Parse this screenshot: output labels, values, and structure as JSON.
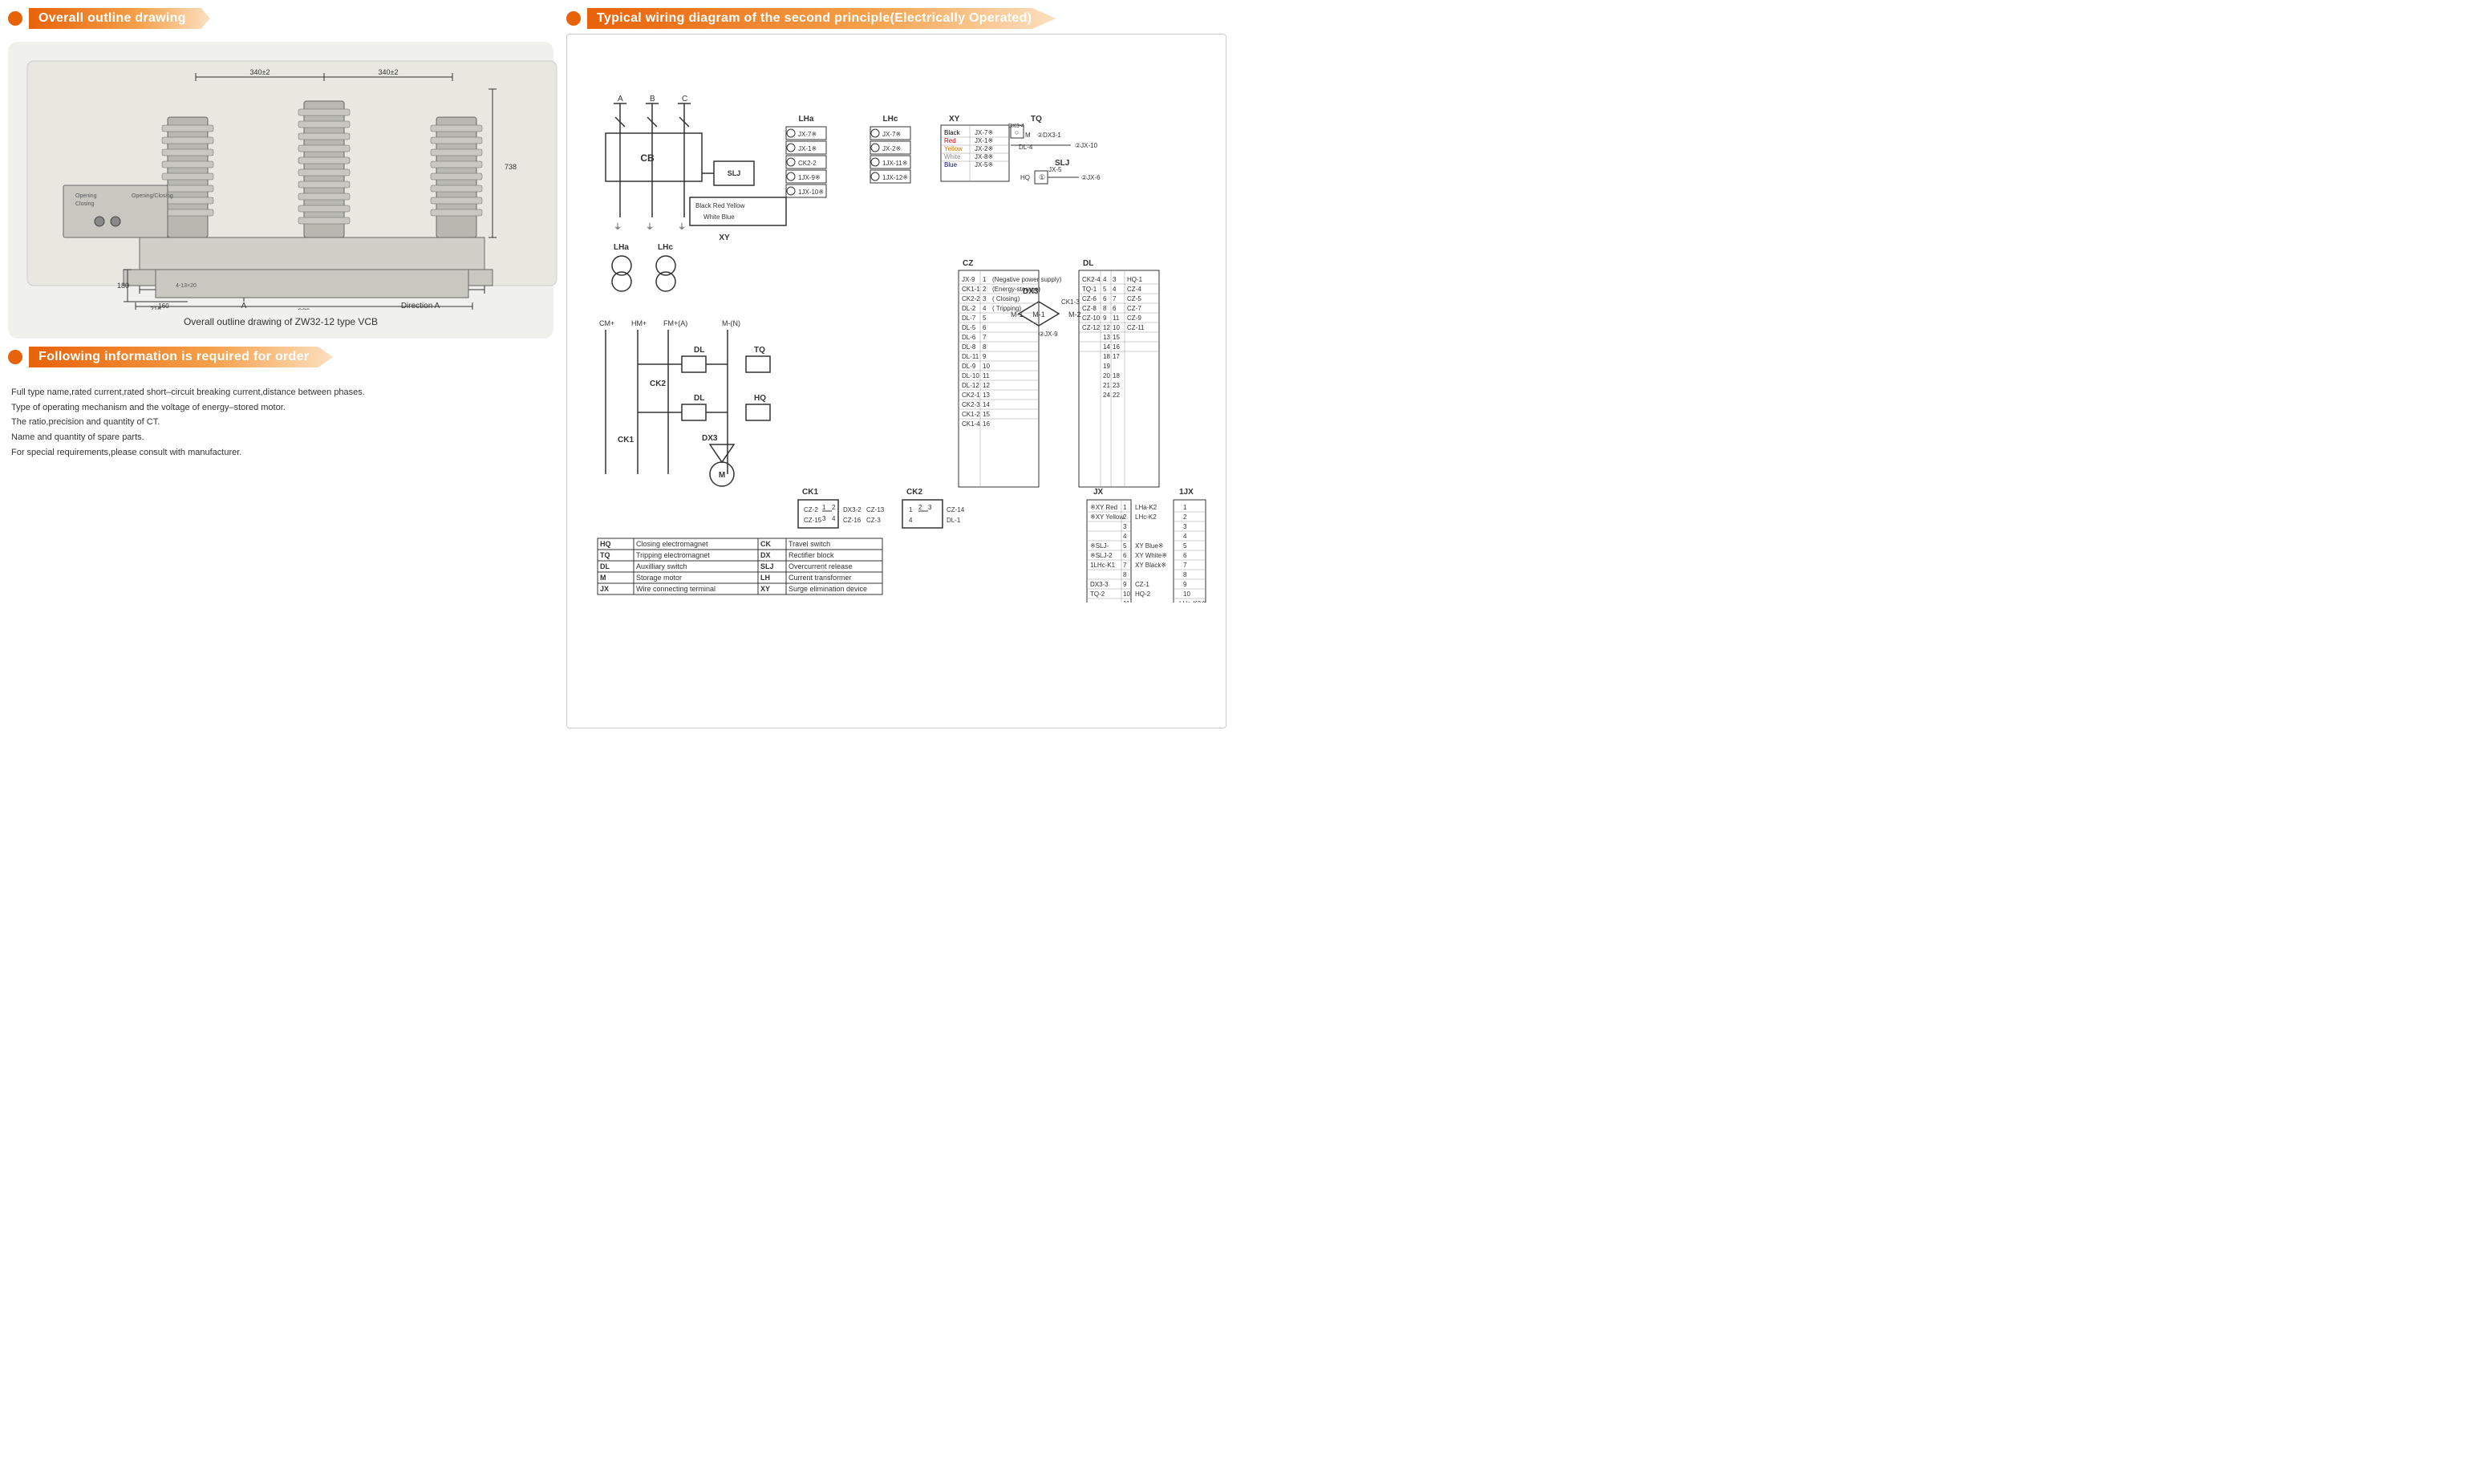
{
  "left": {
    "section1": {
      "title": "Overall outline drawing",
      "caption": "Overall outline drawing of ZW32-12 type VCB"
    },
    "section2": {
      "title": "Following information is required for order",
      "items": [
        "Full type name,rated current,rated short–circuit breaking current,distance between phases.",
        "Type of operating mechanism and the voltage of energy–stored motor.",
        "The ratio,precision and quantity of CT.",
        "Name and quantity of spare parts.",
        "For special requirements,please consult with manufacturer."
      ]
    }
  },
  "right": {
    "title": "Typical wiring diagram of the second principle(Electrically Operated)",
    "colors": {
      "black": "Black",
      "red": "Red",
      "yellow": "Yellow",
      "white": "White",
      "blue": "Blue"
    },
    "components": [
      {
        "code": "HQ",
        "name": "Closing electromagnet",
        "code2": "CK",
        "name2": "Travel switch"
      },
      {
        "code": "TQ",
        "name": "Tripping electromagnet",
        "code2": "DX",
        "name2": "Rectifier block"
      },
      {
        "code": "DL",
        "name": "Auxilliary switch",
        "code2": "SLJ",
        "name2": "Overcurrent release"
      },
      {
        "code": "M",
        "name": "Storage motor",
        "code2": "LH",
        "name2": "Current transformer"
      },
      {
        "code": "JX",
        "name": "Wire connecting terminal",
        "code2": "XY",
        "name2": "Surge elimination device"
      }
    ],
    "labels": {
      "black_red_yellow": "Black Red Yellow",
      "white_blue": "White Blue",
      "xy": "XY",
      "lha": "LHa",
      "lhc": "LHc",
      "cb": "CB",
      "slj": "SLJ",
      "hq": "HQ",
      "tq": "TQ",
      "dx3": "DX3",
      "cz": "CZ",
      "dl": "DL",
      "jx": "JX",
      "onejx": "1JX",
      "ck1": "CK1",
      "ck2": "CK2"
    }
  }
}
